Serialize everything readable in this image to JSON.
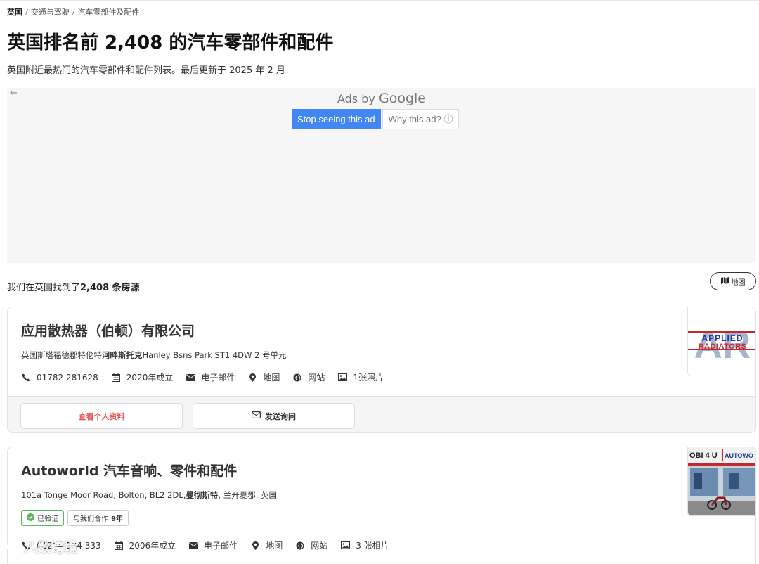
{
  "breadcrumb": {
    "home": "英国",
    "sep": "/",
    "level2": "交通与驾驶",
    "level3": "汽车零部件及配件"
  },
  "title": "英国排名前 2,408 的汽车零部件和配件",
  "subtitle": "英国附近最热门的汽车零部件和配件列表。最后更新于 2025 年 2 月",
  "ad": {
    "back_icon": "arrow-left-icon",
    "ads_by": "Ads by",
    "google": "Google",
    "stop_label": "Stop seeing this ad",
    "why_label": "Why this ad? ⓘ"
  },
  "results": {
    "prefix": "我们在英国找到了",
    "count": "2,408 条房源"
  },
  "map_button": "地图",
  "listings": [
    {
      "name": "应用散热器（伯顿）有限公司",
      "address_pre": "英国斯塔福德郡特伦特",
      "address_bold": "河畔斯托克",
      "address_post": "Hanley Bsns Park ST1 4DW 2 号单元",
      "phone": "01782 281628",
      "founded": "2020年成立",
      "email": "电子邮件",
      "map": "地图",
      "website": "网站",
      "photos": "1张照片",
      "profile_button": "查看个人资料",
      "inquiry_button": "发送询问",
      "logo_text_1": "APPLIED",
      "logo_text_2": "RADIATORS",
      "logo_bg": "AR"
    },
    {
      "name": "Autoworld 汽车音响、零件和配件",
      "address_pre": "101a Tonge Moor Road, Bolton, BL2 2DL,",
      "address_bold": "曼彻斯特",
      "address_post": ", 兰开夏郡, 英国",
      "verified": "已验证",
      "partner_pre": "与我们合作",
      "partner_years": "9年",
      "phone": "01204 534 333",
      "founded": "2006年成立",
      "email": "电子邮件",
      "map": "地图",
      "website": "网站",
      "photos": "3 张相片",
      "sign_left": "OBI 4 U",
      "sign_right": "AUTOWO"
    }
  ],
  "watermark": "八数跨境",
  "colors": {
    "ad_blue": "#4285f4",
    "profile_red": "#e05555",
    "verified_green": "#5cb85c"
  }
}
